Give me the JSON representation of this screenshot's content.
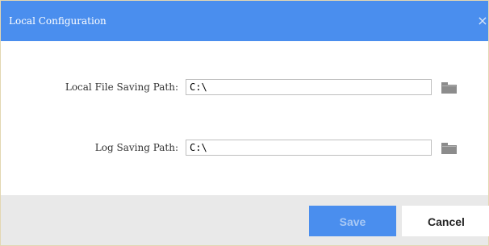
{
  "dialog": {
    "title": "Local Configuration",
    "close_glyph": "×",
    "close_icon": "close-icon"
  },
  "fields": {
    "file_path": {
      "label": "Local File Saving Path:",
      "value": "C:\\",
      "browse_icon": "folder-icon"
    },
    "log_path": {
      "label": "Log Saving Path:",
      "value": "C:\\",
      "browse_icon": "folder-icon"
    }
  },
  "footer": {
    "save_label": "Save",
    "cancel_label": "Cancel"
  },
  "colors": {
    "titlebar": "#4a8eee",
    "save_button": "#4a8eee",
    "footer": "#e9e9e9",
    "folder_icon": "#8c8c8c"
  }
}
